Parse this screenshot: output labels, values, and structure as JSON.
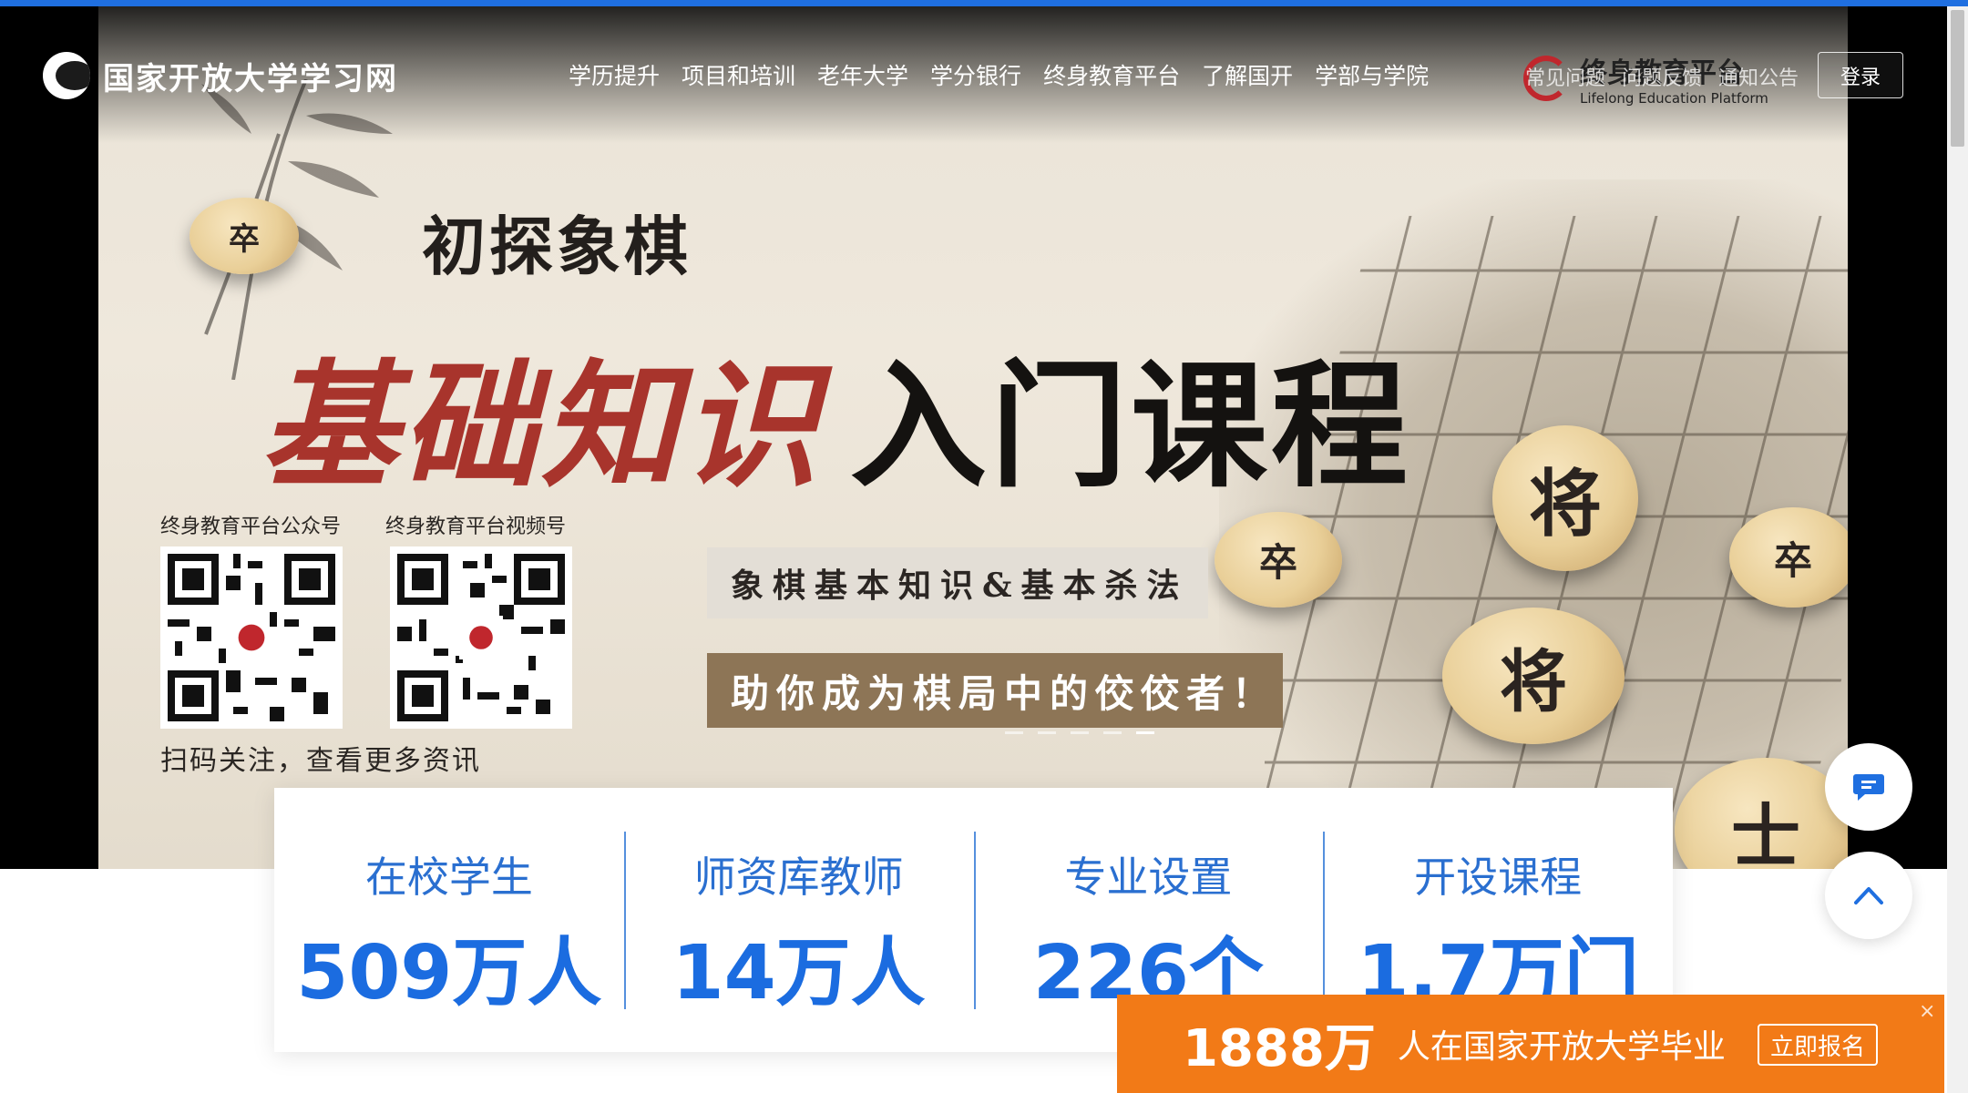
{
  "header": {
    "site_name": "国家开放大学学习网",
    "nav": [
      "学历提升",
      "项目和培训",
      "老年大学",
      "学分银行",
      "终身教育平台",
      "了解国开",
      "学部与学院"
    ],
    "quick_links": [
      "常见问题",
      "问题反馈",
      "通知公告"
    ],
    "login_label": "登录"
  },
  "banner": {
    "partner_cn": "终身教育平台",
    "partner_en": "Lifelong Education Platform",
    "subtitle": "初探象棋",
    "headline_red": "基础知识",
    "headline_black": "入门课程",
    "qr_left_label": "终身教育平台公众号",
    "qr_right_label": "终身教育平台视频号",
    "qr_footer": "扫码关注，查看更多资讯",
    "tag_primary": "象棋基本知识&基本杀法",
    "tag_secondary": "助你成为棋局中的佼佼者！",
    "pieces": {
      "top_left": "卒",
      "general_top": "将",
      "general_mid": "将",
      "left": "卒",
      "right": "卒",
      "bottom_right": "士"
    },
    "slide_count": 5,
    "active_slide": 5
  },
  "stats": [
    {
      "label": "在校学生",
      "value": "509万人"
    },
    {
      "label": "师资库教师",
      "value": "14万人"
    },
    {
      "label": "专业设置",
      "value": "226个"
    },
    {
      "label": "开设课程",
      "value": "1.7万门"
    }
  ],
  "promo": {
    "number": "1888万",
    "text": "人在国家开放大学毕业",
    "button": "立即报名",
    "close": "×"
  },
  "colors": {
    "accent": "#1f6fe0",
    "stat_blue": "#1b6ce0",
    "promo_orange": "#f27a17",
    "headline_red": "#a8342c",
    "tag_brown": "#8d7556"
  }
}
